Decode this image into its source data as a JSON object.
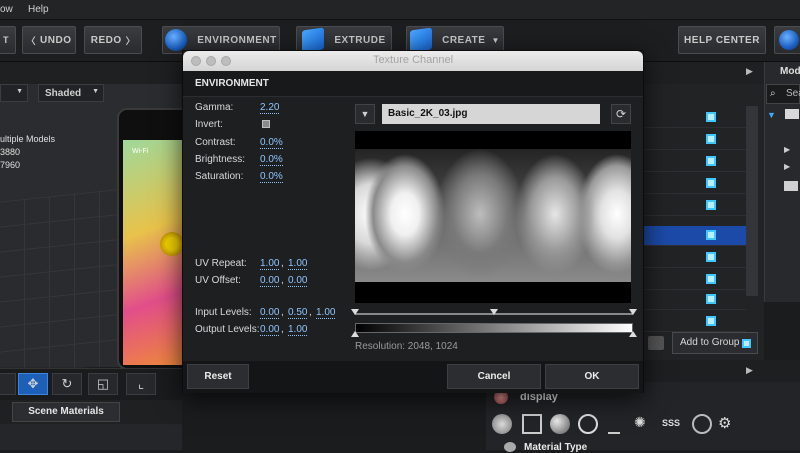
{
  "menubar": {
    "items": [
      "ow",
      "Help"
    ]
  },
  "toolbar": {
    "undo": "UNDO",
    "redo": "REDO",
    "environment": "ENVIRONMENT",
    "extrude": "EXTRUDE",
    "create": "CREATE",
    "help_center": "HELP CENTER"
  },
  "viewport": {
    "view_dropdown": "",
    "shading_dropdown": "Shaded",
    "info": [
      "ultiple Models",
      "3880",
      "7960"
    ],
    "phone_status": "Wi-Fi"
  },
  "scene_tabs": {
    "scene_materials": "Scene Materials"
  },
  "right_panel": {
    "top_label": "Mod",
    "search_placeholder": "Sea",
    "add_to_group": "Add to Group",
    "display": "display",
    "material_type": "Material Type"
  },
  "dialog": {
    "window_title": "Texture Channel",
    "section_title": "ENVIRONMENT",
    "labels": {
      "gamma": "Gamma:",
      "invert": "Invert:",
      "contrast": "Contrast:",
      "brightness": "Brightness:",
      "saturation": "Saturation:",
      "uv_repeat": "UV Repeat:",
      "uv_offset": "UV Offset:",
      "input_levels": "Input Levels:",
      "output_levels": "Output Levels:"
    },
    "values": {
      "gamma": "2.20",
      "contrast": "0.0%",
      "brightness": "0.0%",
      "saturation": "0.0%",
      "uv_repeat_u": "1.00",
      "uv_repeat_v": "1.00",
      "uv_offset_u": "0.00",
      "uv_offset_v": "0.00",
      "input_low": "0.00",
      "input_mid": "0.50",
      "input_high": "1.00",
      "output_low": "0.00",
      "output_high": "1.00"
    },
    "texture_name": "Basic_2K_03.jpg",
    "resolution": "Resolution: 2048, 1024",
    "buttons": {
      "reset": "Reset",
      "cancel": "Cancel",
      "ok": "OK"
    }
  },
  "colors": {
    "accent": "#41c7ff",
    "selected_row": "#1c4aa8",
    "link_value": "#8ec5ff"
  }
}
